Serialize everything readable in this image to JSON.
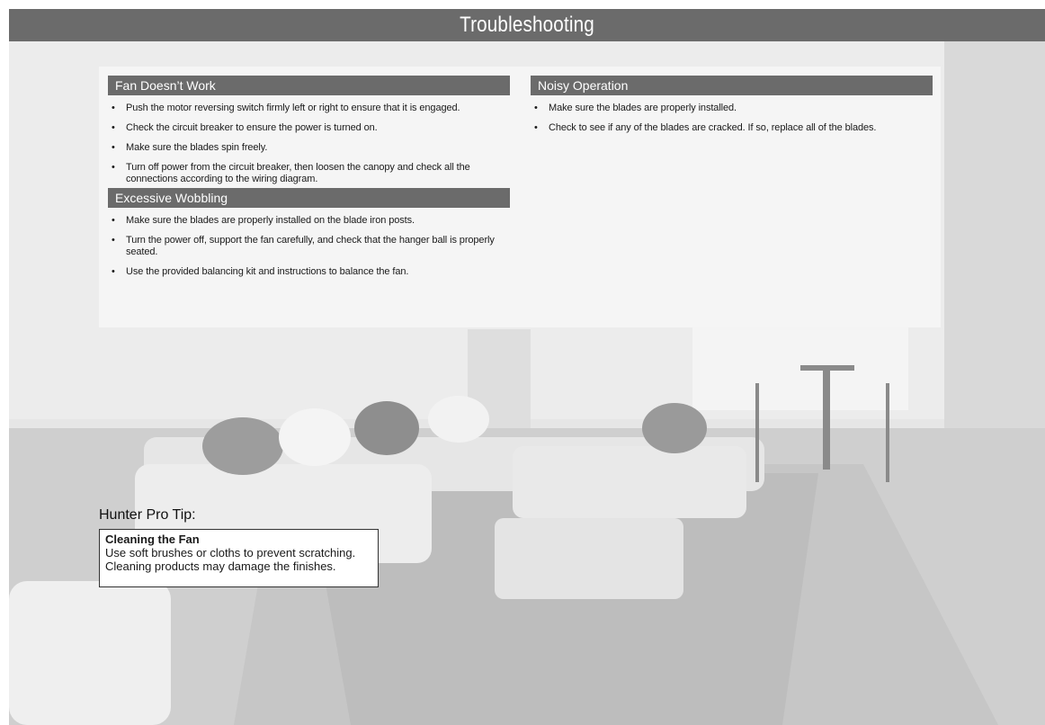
{
  "header": {
    "title": "Troubleshooting"
  },
  "sections": {
    "fan_doesnt_work": {
      "heading": "Fan Doesn’t Work",
      "items": [
        "Push the motor reversing switch firmly left or right to ensure that it is engaged.",
        "Check the circuit breaker to ensure the power is turned on.",
        "Make sure the blades spin freely.",
        "Turn off power from the circuit breaker, then loosen the canopy and check all the connections according to the wiring diagram."
      ]
    },
    "excessive_wobbling": {
      "heading": "Excessive Wobbling",
      "items": [
        "Make sure the blades are properly installed on the blade iron posts.",
        "Turn the power off, support the fan carefully, and check that the hanger ball is properly seated.",
        "Use the provided balancing kit and instructions to balance the fan."
      ]
    },
    "noisy_operation": {
      "heading": "Noisy Operation",
      "items": [
        "Make sure the blades are properly installed.",
        "Check to see if any of the blades are cracked. If so, replace all of the blades."
      ]
    }
  },
  "pro_tip": {
    "title": "Hunter Pro Tip:",
    "heading": "Cleaning the Fan",
    "lines": [
      "Use soft brushes or cloths to prevent scratching.",
      "Cleaning products may damage the finishes."
    ]
  },
  "colors": {
    "header_bg": "#6b6b6b",
    "panel_bg": "#f5f5f5"
  }
}
